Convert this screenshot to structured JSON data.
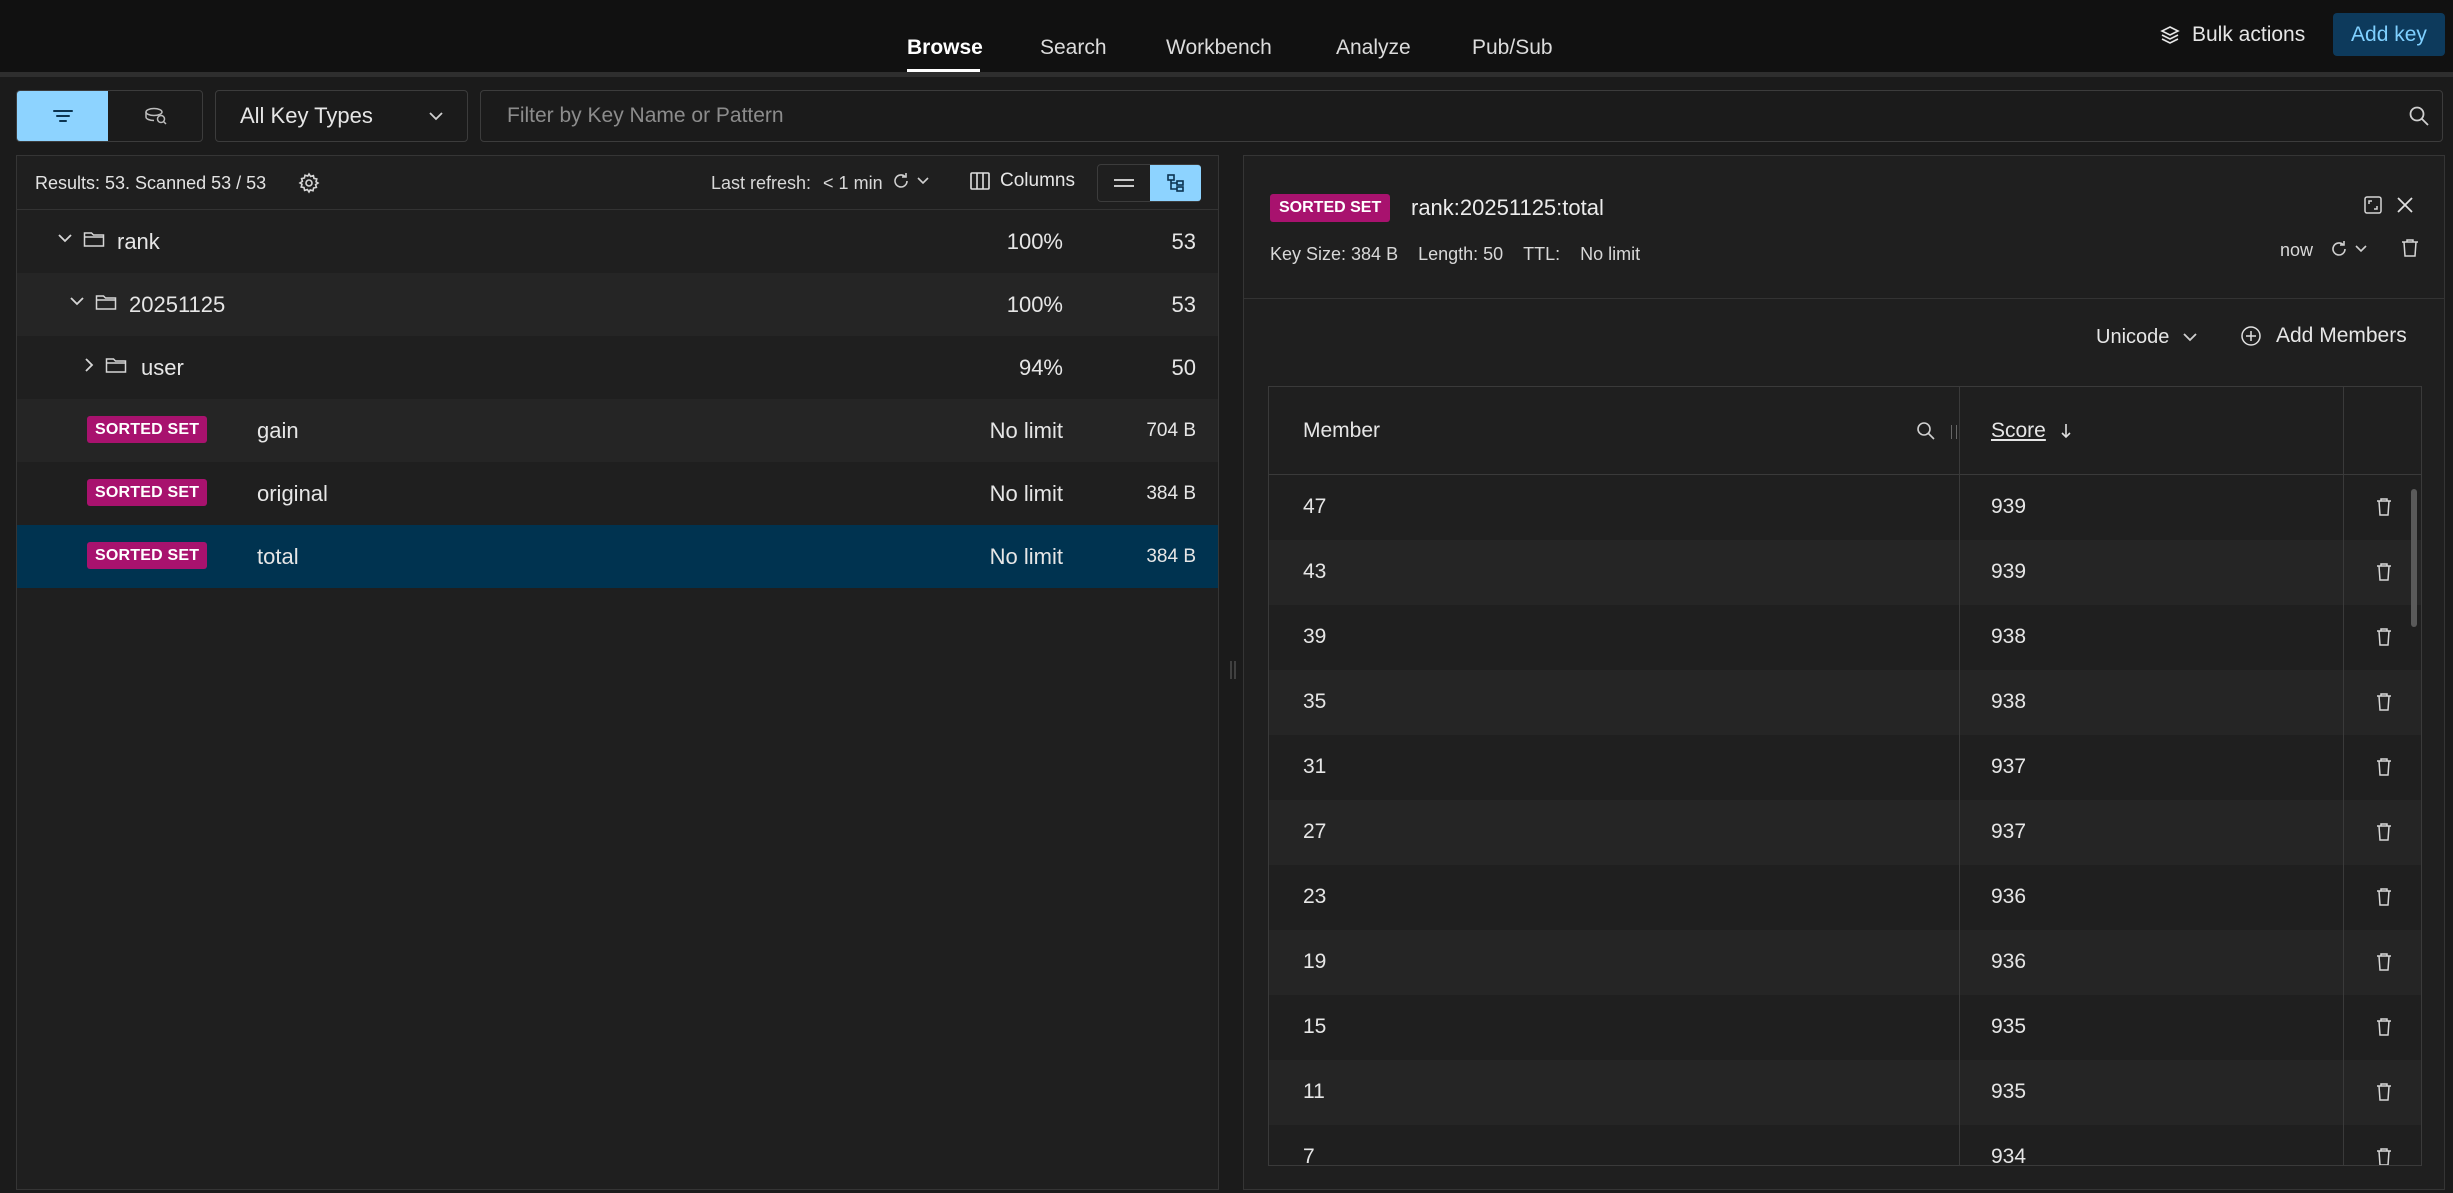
{
  "nav": {
    "tabs": [
      {
        "label": "Browse",
        "active": true
      },
      {
        "label": "Search",
        "active": false
      },
      {
        "label": "Workbench",
        "active": false
      },
      {
        "label": "Analyze",
        "active": false
      },
      {
        "label": "Pub/Sub",
        "active": false
      }
    ],
    "bulk_actions": "Bulk actions",
    "add_key": "Add key"
  },
  "filter": {
    "key_type": "All Key Types",
    "search_placeholder": "Filter by Key Name or Pattern"
  },
  "browser": {
    "results": "Results: 53. Scanned 53 / 53",
    "last_refresh_label": "Last refresh:",
    "last_refresh_value": "< 1 min",
    "columns_label": "Columns",
    "rows": [
      {
        "name": "rank",
        "percent": "100%",
        "count": "53"
      },
      {
        "name": "20251125",
        "percent": "100%",
        "count": "53"
      },
      {
        "name": "user",
        "percent": "94%",
        "count": "50"
      },
      {
        "type": "SORTED SET",
        "name": "gain",
        "ttl": "No limit",
        "size": "704 B"
      },
      {
        "type": "SORTED SET",
        "name": "original",
        "ttl": "No limit",
        "size": "384 B"
      },
      {
        "type": "SORTED SET",
        "name": "total",
        "ttl": "No limit",
        "size": "384 B",
        "selected": true
      }
    ]
  },
  "details": {
    "type": "SORTED SET",
    "key_name": "rank:20251125:total",
    "key_size": "Key Size: 384 B",
    "length": "Length: 50",
    "ttl_label": "TTL:",
    "ttl_value": "No limit",
    "refreshed": "now",
    "encoding": "Unicode",
    "add_members": "Add Members",
    "columns": {
      "member": "Member",
      "score": "Score"
    },
    "members": [
      {
        "member": "47",
        "score": "939"
      },
      {
        "member": "43",
        "score": "939"
      },
      {
        "member": "39",
        "score": "938"
      },
      {
        "member": "35",
        "score": "938"
      },
      {
        "member": "31",
        "score": "937"
      },
      {
        "member": "27",
        "score": "937"
      },
      {
        "member": "23",
        "score": "936"
      },
      {
        "member": "19",
        "score": "936"
      },
      {
        "member": "15",
        "score": "935"
      },
      {
        "member": "11",
        "score": "935"
      },
      {
        "member": "7",
        "score": "934"
      }
    ]
  },
  "colors": {
    "accent": "#8dd3ff",
    "sorted_set_badge": "#a8126e",
    "selected_row": "#003350",
    "add_key_bg": "#0d3a5c"
  },
  "icons": [
    "filter-icon",
    "tree-view-icon",
    "chevron-down-icon",
    "search-icon",
    "layers-icon",
    "gear-icon",
    "refresh-icon",
    "columns-icon",
    "list-icon",
    "folder-icon",
    "chevron-right-icon",
    "expand-icon",
    "close-icon",
    "trash-icon",
    "add-circle-icon",
    "sort-down-icon"
  ]
}
